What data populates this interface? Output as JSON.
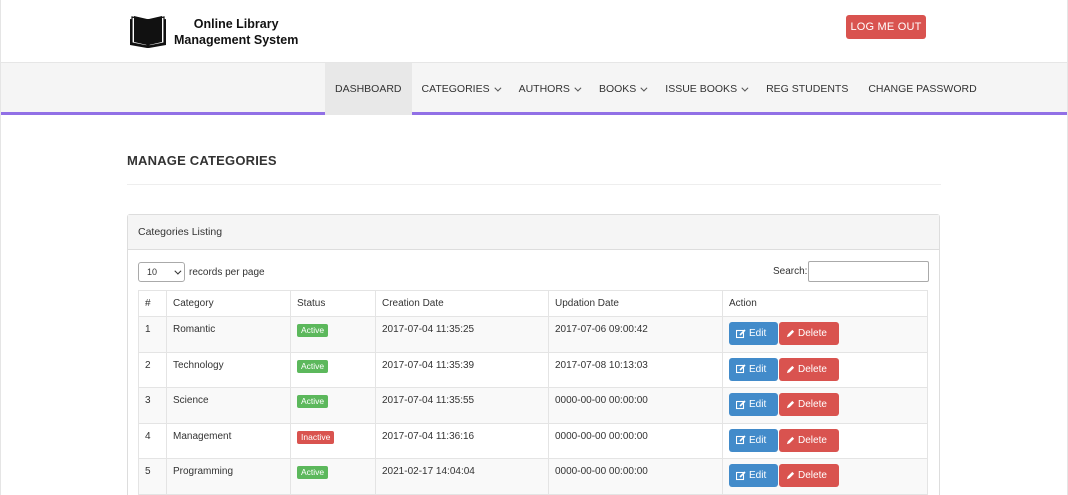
{
  "header": {
    "logo_line1": "Online Library",
    "logo_line2": "Management System",
    "logout_label": "LOG ME OUT"
  },
  "nav": {
    "items": [
      {
        "label": "DASHBOARD",
        "dropdown": false,
        "active": true
      },
      {
        "label": "CATEGORIES",
        "dropdown": true
      },
      {
        "label": "AUTHORS",
        "dropdown": true
      },
      {
        "label": "BOOKS",
        "dropdown": true
      },
      {
        "label": "ISSUE BOOKS",
        "dropdown": true
      },
      {
        "label": "REG STUDENTS",
        "dropdown": false
      },
      {
        "label": "CHANGE PASSWORD",
        "dropdown": false
      }
    ]
  },
  "page": {
    "title": "MANAGE CATEGORIES"
  },
  "panel": {
    "heading": "Categories Listing",
    "length_value": "10",
    "length_label": "records per page",
    "search_label": "Search:",
    "search_value": ""
  },
  "table": {
    "headers": [
      "#",
      "Category",
      "Status",
      "Creation Date",
      "Updation Date",
      "Action"
    ],
    "edit_label": "Edit",
    "delete_label": "Delete",
    "rows": [
      {
        "num": "1",
        "category": "Romantic",
        "status": "Active",
        "created": "2017-07-04 11:35:25",
        "updated": "2017-07-06 09:00:42"
      },
      {
        "num": "2",
        "category": "Technology",
        "status": "Active",
        "created": "2017-07-04 11:35:39",
        "updated": "2017-07-08 10:13:03"
      },
      {
        "num": "3",
        "category": "Science",
        "status": "Active",
        "created": "2017-07-04 11:35:55",
        "updated": "0000-00-00 00:00:00"
      },
      {
        "num": "4",
        "category": "Management",
        "status": "Inactive",
        "created": "2017-07-04 11:36:16",
        "updated": "0000-00-00 00:00:00"
      },
      {
        "num": "5",
        "category": "Programming",
        "status": "Active",
        "created": "2021-02-17 14:04:04",
        "updated": "0000-00-00 00:00:00"
      }
    ]
  },
  "colors": {
    "nav_accent": "#9170e6",
    "danger": "#d9534f",
    "primary": "#428bca",
    "success": "#5cb85c"
  },
  "icons": {
    "logo": "book-icon",
    "edit": "edit-icon",
    "delete": "pencil-icon"
  }
}
